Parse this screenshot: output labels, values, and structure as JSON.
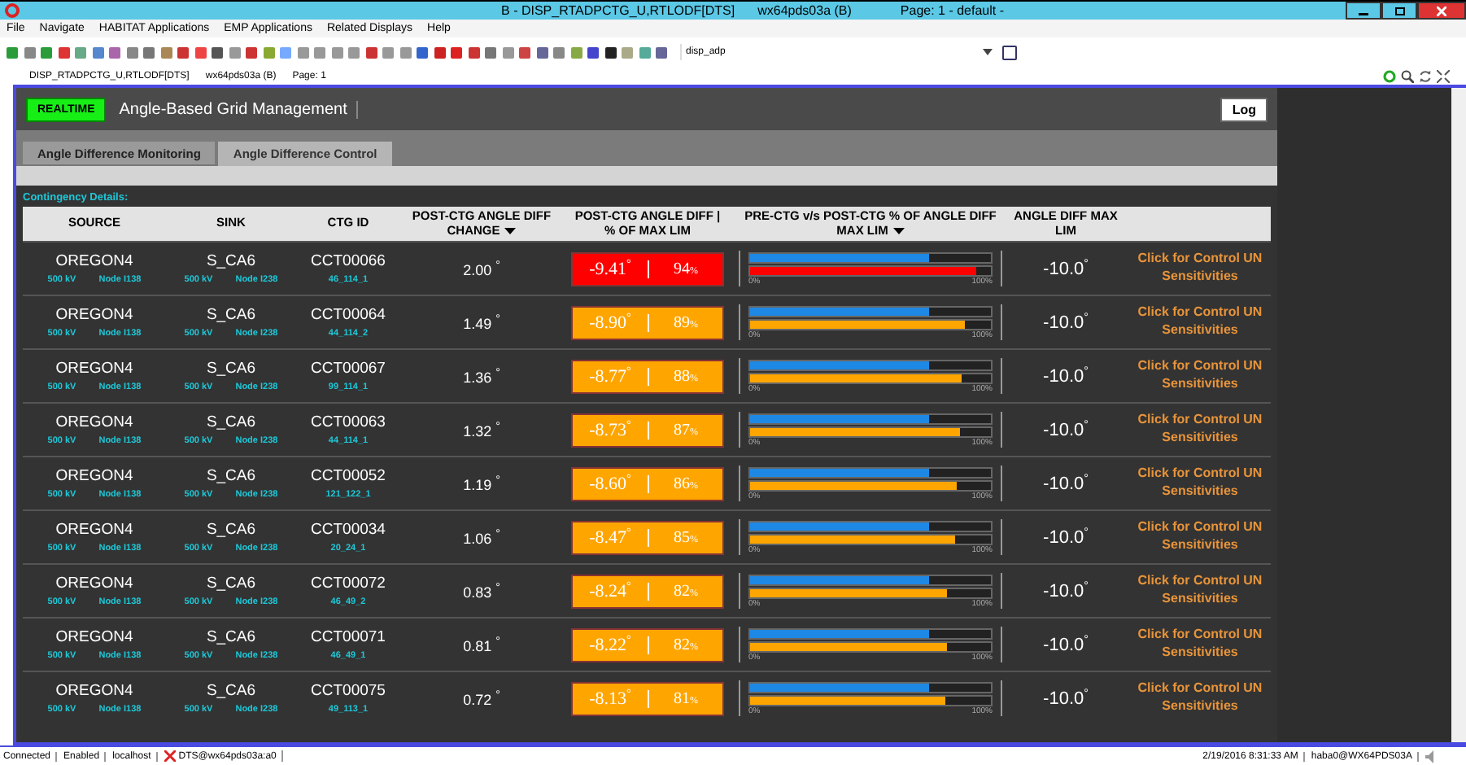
{
  "window": {
    "title": "B - DISP_RTADPCTG_U,RTLODF[DTS]",
    "host": "wx64pds03a (B)",
    "page": "Page: 1 - default -"
  },
  "menu": [
    "File",
    "Navigate",
    "HABITAT Applications",
    "EMP Applications",
    "Related Displays",
    "Help"
  ],
  "toolbar": {
    "display_field": "disp_adp"
  },
  "doc_tabs": [
    "DISP_RTADPCTG_U,RTLODF[DTS]",
    "wx64pds03a (B)",
    "Page: 1"
  ],
  "header": {
    "mode": "REALTIME",
    "title": "Angle-Based Grid Management",
    "log_button": "Log"
  },
  "tabs": [
    {
      "label": "Angle Difference Monitoring",
      "selected": true
    },
    {
      "label": "Angle Difference Control",
      "selected": false
    }
  ],
  "section_label": "Contingency Details:",
  "table": {
    "columns": [
      "SOURCE",
      "SINK",
      "CTG ID",
      "POST-CTG ANGLE DIFF CHANGE",
      "POST-CTG ANGLE DIFF | % OF MAX LIM",
      "PRE-CTG v/s POST-CTG % OF ANGLE DIFF MAX LIM",
      "ANGLE DIFF MAX LIM"
    ],
    "sorted": [
      false,
      false,
      false,
      true,
      false,
      true,
      false
    ],
    "rows": [
      {
        "source": "OREGON4",
        "source_kv": "500 kV",
        "source_node": "Node I138",
        "sink": "S_CA6",
        "sink_kv": "500 kV",
        "sink_node": "Node I238",
        "ctg_id": "CCT00066",
        "ctg_sub": "46_114_1",
        "change": "2.00",
        "post_angle": "-9.41",
        "post_pct": "94",
        "color": "#ff0000",
        "pre_bar": {
          "level": 0.74
        },
        "post_bar": {
          "level": 0.94
        },
        "bar_min": "0%",
        "bar_max": "100%",
        "max_lim": "-10.0",
        "link": "Click for Control UN Sensitivities"
      },
      {
        "source": "OREGON4",
        "source_kv": "500 kV",
        "source_node": "Node I138",
        "sink": "S_CA6",
        "sink_kv": "500 kV",
        "sink_node": "Node I238",
        "ctg_id": "CCT00064",
        "ctg_sub": "44_114_2",
        "change": "1.49",
        "post_angle": "-8.90",
        "post_pct": "89",
        "color": "#ffa500",
        "pre_bar": {
          "level": 0.74
        },
        "post_bar": {
          "level": 0.89
        },
        "bar_min": "0%",
        "bar_max": "100%",
        "max_lim": "-10.0",
        "link": "Click for Control UN Sensitivities"
      },
      {
        "source": "OREGON4",
        "source_kv": "500 kV",
        "source_node": "Node I138",
        "sink": "S_CA6",
        "sink_kv": "500 kV",
        "sink_node": "Node I238",
        "ctg_id": "CCT00067",
        "ctg_sub": "99_114_1",
        "change": "1.36",
        "post_angle": "-8.77",
        "post_pct": "88",
        "color": "#ffa500",
        "pre_bar": {
          "level": 0.74
        },
        "post_bar": {
          "level": 0.88
        },
        "bar_min": "0%",
        "bar_max": "100%",
        "max_lim": "-10.0",
        "link": "Click for Control UN Sensitivities"
      },
      {
        "source": "OREGON4",
        "source_kv": "500 kV",
        "source_node": "Node I138",
        "sink": "S_CA6",
        "sink_kv": "500 kV",
        "sink_node": "Node I238",
        "ctg_id": "CCT00063",
        "ctg_sub": "44_114_1",
        "change": "1.32",
        "post_angle": "-8.73",
        "post_pct": "87",
        "color": "#ffa500",
        "pre_bar": {
          "level": 0.74
        },
        "post_bar": {
          "level": 0.87
        },
        "bar_min": "0%",
        "bar_max": "100%",
        "max_lim": "-10.0",
        "link": "Click for Control UN Sensitivities"
      },
      {
        "source": "OREGON4",
        "source_kv": "500 kV",
        "source_node": "Node I138",
        "sink": "S_CA6",
        "sink_kv": "500 kV",
        "sink_node": "Node I238",
        "ctg_id": "CCT00052",
        "ctg_sub": "121_122_1",
        "change": "1.19",
        "post_angle": "-8.60",
        "post_pct": "86",
        "color": "#ffa500",
        "pre_bar": {
          "level": 0.74
        },
        "post_bar": {
          "level": 0.86
        },
        "bar_min": "0%",
        "bar_max": "100%",
        "max_lim": "-10.0",
        "link": "Click for Control UN Sensitivities"
      },
      {
        "source": "OREGON4",
        "source_kv": "500 kV",
        "source_node": "Node I138",
        "sink": "S_CA6",
        "sink_kv": "500 kV",
        "sink_node": "Node I238",
        "ctg_id": "CCT00034",
        "ctg_sub": "20_24_1",
        "change": "1.06",
        "post_angle": "-8.47",
        "post_pct": "85",
        "color": "#ffa500",
        "pre_bar": {
          "level": 0.74
        },
        "post_bar": {
          "level": 0.85
        },
        "bar_min": "0%",
        "bar_max": "100%",
        "max_lim": "-10.0",
        "link": "Click for Control UN Sensitivities"
      },
      {
        "source": "OREGON4",
        "source_kv": "500 kV",
        "source_node": "Node I138",
        "sink": "S_CA6",
        "sink_kv": "500 kV",
        "sink_node": "Node I238",
        "ctg_id": "CCT00072",
        "ctg_sub": "46_49_2",
        "change": "0.83",
        "post_angle": "-8.24",
        "post_pct": "82",
        "color": "#ffa500",
        "pre_bar": {
          "level": 0.74
        },
        "post_bar": {
          "level": 0.82
        },
        "bar_min": "0%",
        "bar_max": "100%",
        "max_lim": "-10.0",
        "link": "Click for Control UN Sensitivities"
      },
      {
        "source": "OREGON4",
        "source_kv": "500 kV",
        "source_node": "Node I138",
        "sink": "S_CA6",
        "sink_kv": "500 kV",
        "sink_node": "Node I238",
        "ctg_id": "CCT00071",
        "ctg_sub": "46_49_1",
        "change": "0.81",
        "post_angle": "-8.22",
        "post_pct": "82",
        "color": "#ffa500",
        "pre_bar": {
          "level": 0.74
        },
        "post_bar": {
          "level": 0.82
        },
        "bar_min": "0%",
        "bar_max": "100%",
        "max_lim": "-10.0",
        "link": "Click for Control UN Sensitivities"
      },
      {
        "source": "OREGON4",
        "source_kv": "500 kV",
        "source_node": "Node I138",
        "sink": "S_CA6",
        "sink_kv": "500 kV",
        "sink_node": "Node I238",
        "ctg_id": "CCT00075",
        "ctg_sub": "49_113_1",
        "change": "0.72",
        "post_angle": "-8.13",
        "post_pct": "81",
        "color": "#ffa500",
        "pre_bar": {
          "level": 0.74
        },
        "post_bar": {
          "level": 0.81
        },
        "bar_min": "0%",
        "bar_max": "100%",
        "max_lim": "-10.0",
        "link": "Click for Control UN Sensitivities"
      }
    ],
    "unit_deg": "°",
    "unit_pct": "%"
  },
  "status_bar": {
    "left": [
      "Connected",
      "Enabled",
      "localhost",
      "DTS@wx64pds03a:a0"
    ],
    "datetime": "2/19/2016 8:31:33 AM",
    "user": "haba0@WX64PDS03A"
  }
}
